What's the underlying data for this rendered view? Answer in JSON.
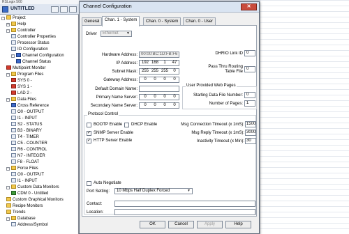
{
  "project": {
    "top_text": "RSLogix 500",
    "title": "UNTITLED",
    "items": [
      {
        "label": "Project",
        "level": 0,
        "icon": "folder-icon",
        "exp": "-"
      },
      {
        "label": "Help",
        "level": 1,
        "icon": "folder-icon",
        "exp": "+"
      },
      {
        "label": "Controller",
        "level": 1,
        "icon": "folder-icon",
        "exp": "-"
      },
      {
        "label": "Controller Properties",
        "level": 2,
        "icon": "properties-icon",
        "exp": ""
      },
      {
        "label": "Processor Status",
        "level": 2,
        "icon": "status-icon",
        "exp": ""
      },
      {
        "label": "IO Configuration",
        "level": 2,
        "icon": "io-config-icon",
        "exp": ""
      },
      {
        "label": "Channel Configuration",
        "level": 2,
        "icon": "channel-config-icon",
        "exp": "-"
      },
      {
        "label": "Channel Status",
        "level": 3,
        "icon": "channel-status-icon",
        "exp": ""
      },
      {
        "label": "Multipoint Monitor",
        "level": 1,
        "icon": "monitor-icon",
        "exp": ""
      },
      {
        "label": "Program Files",
        "level": 1,
        "icon": "folder-icon",
        "exp": "-"
      },
      {
        "label": "SYS 0 -",
        "level": 2,
        "icon": "program-file-icon",
        "exp": ""
      },
      {
        "label": "SYS 1 -",
        "level": 2,
        "icon": "program-file-icon",
        "exp": ""
      },
      {
        "label": "LAD 2 -",
        "level": 2,
        "icon": "ladder-file-icon",
        "exp": ""
      },
      {
        "label": "Data Files",
        "level": 1,
        "icon": "folder-icon",
        "exp": "-"
      },
      {
        "label": "Cross Reference",
        "level": 2,
        "icon": "cross-reference-icon",
        "exp": ""
      },
      {
        "label": "O0 - OUTPUT",
        "level": 2,
        "icon": "data-file-icon",
        "exp": ""
      },
      {
        "label": "I1 - INPUT",
        "level": 2,
        "icon": "data-file-icon",
        "exp": ""
      },
      {
        "label": "S2 - STATUS",
        "level": 2,
        "icon": "data-file-icon",
        "exp": ""
      },
      {
        "label": "B3 - BINARY",
        "level": 2,
        "icon": "data-file-icon",
        "exp": ""
      },
      {
        "label": "T4 - TIMER",
        "level": 2,
        "icon": "data-file-icon",
        "exp": ""
      },
      {
        "label": "C5 - COUNTER",
        "level": 2,
        "icon": "data-file-icon",
        "exp": ""
      },
      {
        "label": "R6 - CONTROL",
        "level": 2,
        "icon": "data-file-icon",
        "exp": ""
      },
      {
        "label": "N7 - INTEGER",
        "level": 2,
        "icon": "data-file-icon",
        "exp": ""
      },
      {
        "label": "F8 - FLOAT",
        "level": 2,
        "icon": "data-file-icon",
        "exp": ""
      },
      {
        "label": "Force Files",
        "level": 1,
        "icon": "folder-icon",
        "exp": "-"
      },
      {
        "label": "O0 - OUTPUT",
        "level": 2,
        "icon": "force-file-icon",
        "exp": ""
      },
      {
        "label": "I1 - INPUT",
        "level": 2,
        "icon": "force-file-icon",
        "exp": ""
      },
      {
        "label": "Custom Data Monitors",
        "level": 1,
        "icon": "folder-icon",
        "exp": "-"
      },
      {
        "label": "CDM 0 - Untitled",
        "level": 2,
        "icon": "cdm-icon",
        "exp": ""
      },
      {
        "label": "Custom Graphical Monitors",
        "level": 1,
        "icon": "folder-icon",
        "exp": ""
      },
      {
        "label": "Recipe Monitors",
        "level": 1,
        "icon": "folder-icon",
        "exp": ""
      },
      {
        "label": "Trends",
        "level": 1,
        "icon": "folder-icon",
        "exp": ""
      },
      {
        "label": "Database",
        "level": 1,
        "icon": "folder-icon",
        "exp": "-"
      },
      {
        "label": "Address/Symbol",
        "level": 2,
        "icon": "address-symbol-icon",
        "exp": ""
      }
    ]
  },
  "dialog": {
    "title": "Channel Configuration",
    "close_glyph": "✕",
    "tabs": [
      {
        "label": "General",
        "active": false
      },
      {
        "label": "Chan. 1 - System",
        "active": true
      },
      {
        "label": "Chan. 0 - System",
        "active": false
      },
      {
        "label": "Chan. 0 - User",
        "active": false
      }
    ],
    "driver_label": "Driver",
    "driver_value": "Ethernet",
    "hw_address_label": "Hardware Address:",
    "hw_address_value": "00:00:BC:1D:FB:F6",
    "ip_label": "IP Address:",
    "ip": [
      "192",
      "168",
      "1",
      "47"
    ],
    "subnet_label": "Subnet Mask:",
    "subnet": [
      "255",
      "255",
      "255",
      "0"
    ],
    "gateway_label": "Gateway Address:",
    "gateway": [
      "0",
      "0",
      "0",
      "0"
    ],
    "domain_label": "Default Domain Name:",
    "domain_value": "",
    "primary_ns_label": "Primary Name Server:",
    "primary_ns": [
      "0",
      "0",
      "0",
      "0"
    ],
    "secondary_ns_label": "Secondary Name Server:",
    "secondary_ns": [
      "0",
      "0",
      "0",
      "0"
    ],
    "dhrio_label": "DHRIO Link ID",
    "dhrio_value": "0",
    "pass_thru_label_1": "Pass Thru Routing",
    "pass_thru_label_2": "Table File",
    "pass_thru_value": "0",
    "web_group_title": "User Provided Web Pages",
    "start_file_label": "Starting Data File Number:",
    "start_file_value": "0",
    "num_pages_label": "Number of Pages:",
    "num_pages_value": "1",
    "protocol_group_title": "Protocol Control",
    "bootp_label": "BOOTP Enable",
    "bootp_checked": false,
    "dhcp_label": "DHCP Enable",
    "dhcp_checked": false,
    "snmp_label": "SNMP Server Enable",
    "snmp_checked": true,
    "http_label": "HTTP Server Enable",
    "http_checked": true,
    "msg_conn_label": "Msg Connection Timeout (x 1mS):",
    "msg_conn_value": "15000",
    "msg_reply_label": "Msg Reply Timeout (x 1mS):",
    "msg_reply_value": "3000",
    "inactivity_label": "Inactivity Timeout (x Min):",
    "inactivity_value": "30",
    "auto_neg_label": "Auto Negotiate",
    "auto_neg_checked": false,
    "port_setting_label": "Port Setting:",
    "port_setting_value": "10 Mbps Half Duplex Forced",
    "contact_label": "Contact:",
    "contact_value": "",
    "location_label": "Location:",
    "location_value": "",
    "check_glyph": "✓",
    "dropdown_glyph": "▼",
    "ok_label": "OK",
    "cancel_label": "Cancel",
    "apply_label": "Apply",
    "help_label": "Help"
  }
}
